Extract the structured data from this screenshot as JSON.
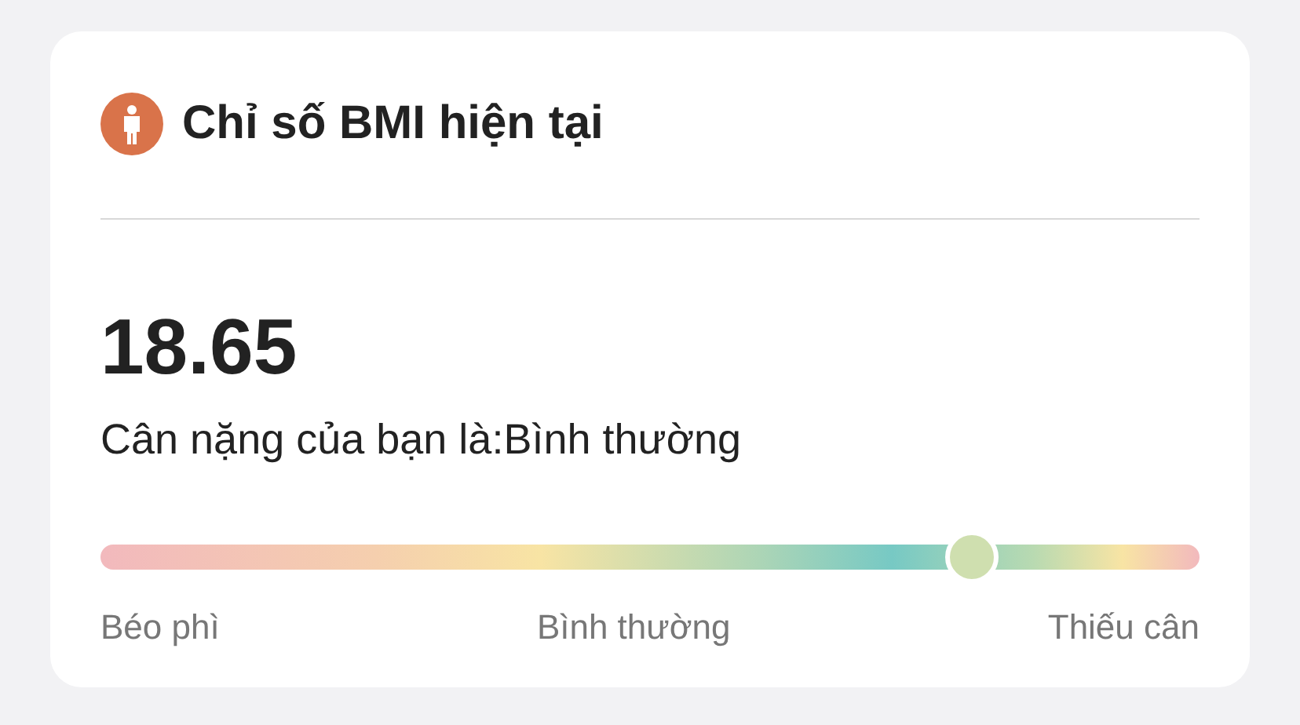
{
  "card": {
    "title": "Chỉ số BMI hiện tại",
    "value": "18.65",
    "status": "Cân nặng của bạn là:Bình thường",
    "scale": {
      "level": 0.793,
      "labels": [
        "Béo phì",
        "Bình thường",
        "Thiếu cân"
      ]
    }
  }
}
